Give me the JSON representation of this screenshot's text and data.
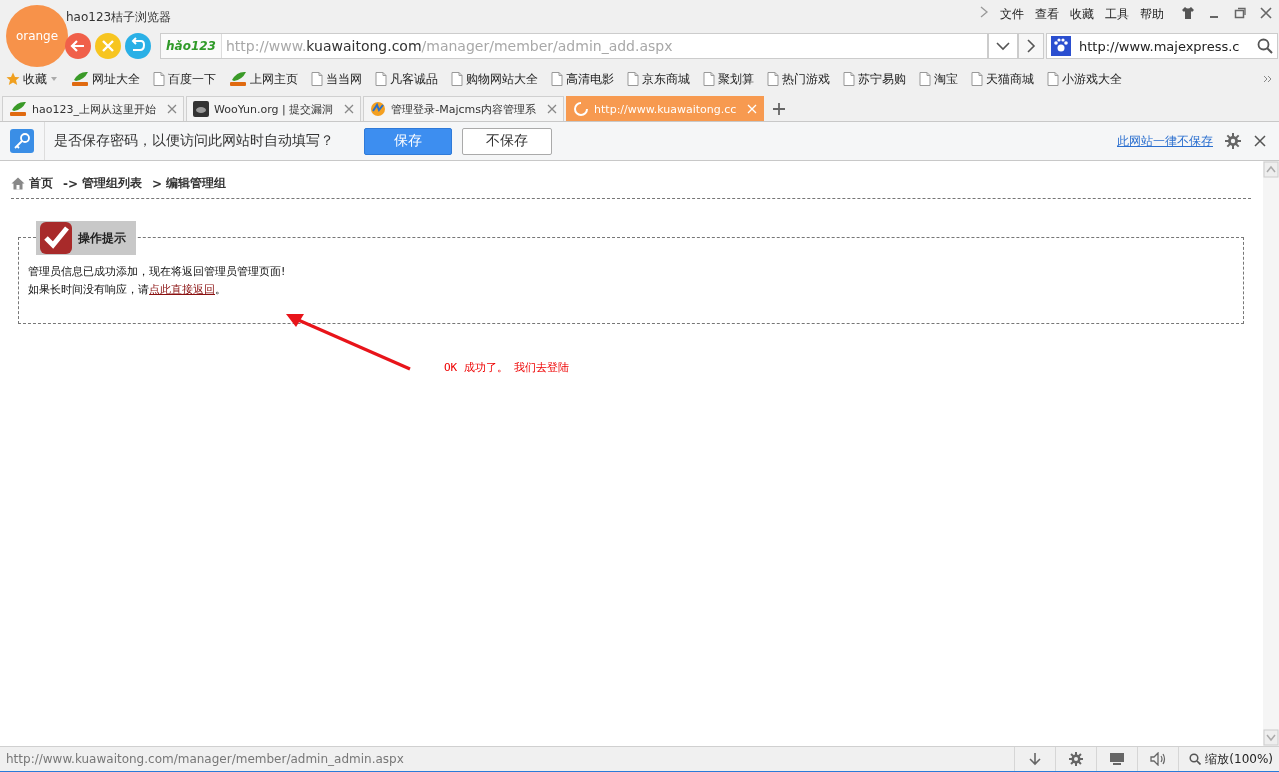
{
  "browser": {
    "logo_text": "orange",
    "title": "hao123桔子浏览器",
    "menu": [
      "文件",
      "查看",
      "收藏",
      "工具",
      "帮助"
    ]
  },
  "address_bar": {
    "badge": "hǎo123",
    "url": [
      {
        "text": "http://www.",
        "kind": "dim"
      },
      {
        "text": "kuawaitong.com",
        "kind": "host"
      },
      {
        "text": "/manager/member/admin_add.aspx",
        "kind": "dim"
      }
    ]
  },
  "search_box": {
    "value": "http://www.majexpress.c"
  },
  "bookmarks": [
    {
      "label": "收藏",
      "kind": "star"
    },
    {
      "label": "网址大全",
      "kind": "hao"
    },
    {
      "label": "百度一下",
      "kind": "page"
    },
    {
      "label": "上网主页",
      "kind": "hao"
    },
    {
      "label": "当当网",
      "kind": "page"
    },
    {
      "label": "凡客诚品",
      "kind": "page"
    },
    {
      "label": "购物网站大全",
      "kind": "page"
    },
    {
      "label": "高清电影",
      "kind": "page"
    },
    {
      "label": "京东商城",
      "kind": "page"
    },
    {
      "label": "聚划算",
      "kind": "page"
    },
    {
      "label": "热门游戏",
      "kind": "page"
    },
    {
      "label": "苏宁易购",
      "kind": "page"
    },
    {
      "label": "淘宝",
      "kind": "page"
    },
    {
      "label": "天猫商城",
      "kind": "page"
    },
    {
      "label": "小游戏大全",
      "kind": "page"
    }
  ],
  "tabs": [
    {
      "label": "hao123_上网从这里开始",
      "selected": false
    },
    {
      "label": "WooYun.org | 提交漏洞",
      "selected": false
    },
    {
      "label": "管理登录-Majcms内容管理系",
      "selected": false
    },
    {
      "label": "http://www.kuawaitong.cc",
      "selected": true
    }
  ],
  "password_bar": {
    "question": "是否保存密码，以便访问此网站时自动填写？",
    "save": "保存",
    "dont_save": "不保存",
    "never_link": "此网站一律不保存"
  },
  "page": {
    "breadcrumb": [
      {
        "text": "首页"
      },
      {
        "sep": "->",
        "text": "管理组列表"
      },
      {
        "sep": ">",
        "text": "编辑管理组"
      }
    ],
    "notice": {
      "title": "操作提示",
      "line_1": "管理员信息已成功添加，现在将返回管理员管理页面!",
      "line_2_before": "如果长时间没有响应，请",
      "line_2_link": "点此直接返回",
      "line_2_after": "。"
    },
    "annotation": "OK 成功了。 我们去登陆"
  },
  "status_bar": {
    "url": "http://www.kuawaitong.com/manager/member/admin_admin.aspx",
    "zoom": "缩放(100%)"
  }
}
